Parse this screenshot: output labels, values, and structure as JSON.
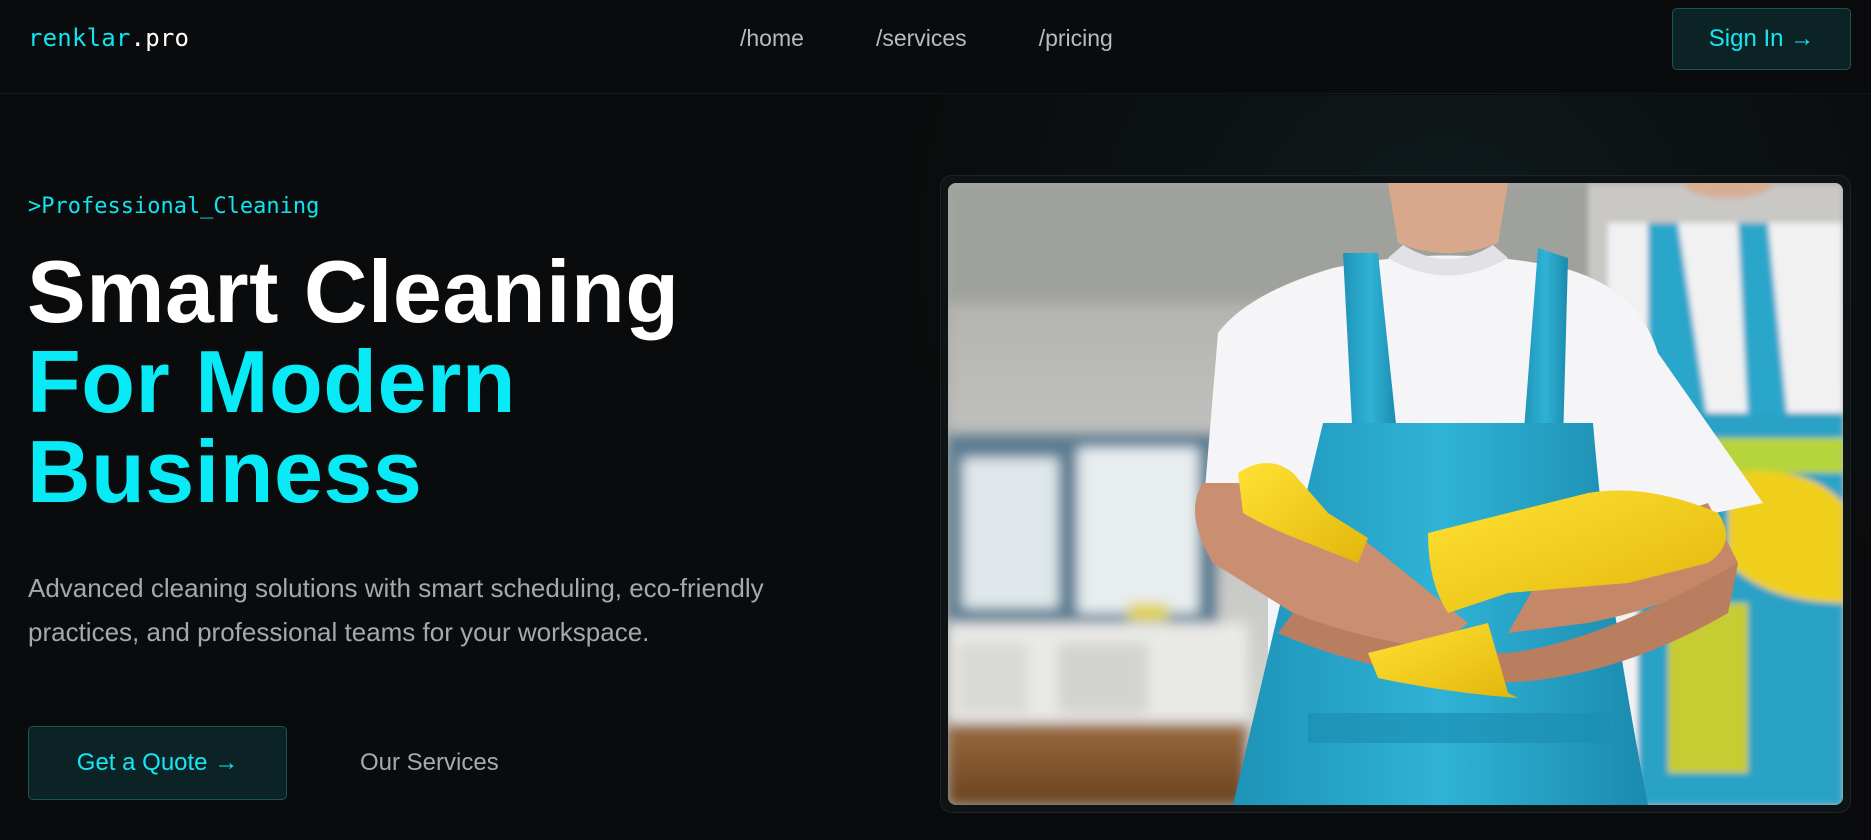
{
  "nav": {
    "logo_main": "renklar",
    "logo_tld": ".pro",
    "links": [
      "/home",
      "/services",
      "/pricing"
    ],
    "sign_in": "Sign In →"
  },
  "hero": {
    "eyebrow": ">Professional_Cleaning",
    "headline_1": "Smart Cleaning",
    "headline_2": "For Modern",
    "headline_3": "Business",
    "description": "Advanced cleaning solutions with smart scheduling, eco-friendly practices, and professional teams for your workspace.",
    "cta_primary": "Get a Quote →",
    "cta_secondary": "Our Services"
  },
  "colors": {
    "accent": "#09eaf7",
    "background": "#0a0b0c",
    "apron": "#2aa9cc",
    "glove": "#f2d21a"
  }
}
